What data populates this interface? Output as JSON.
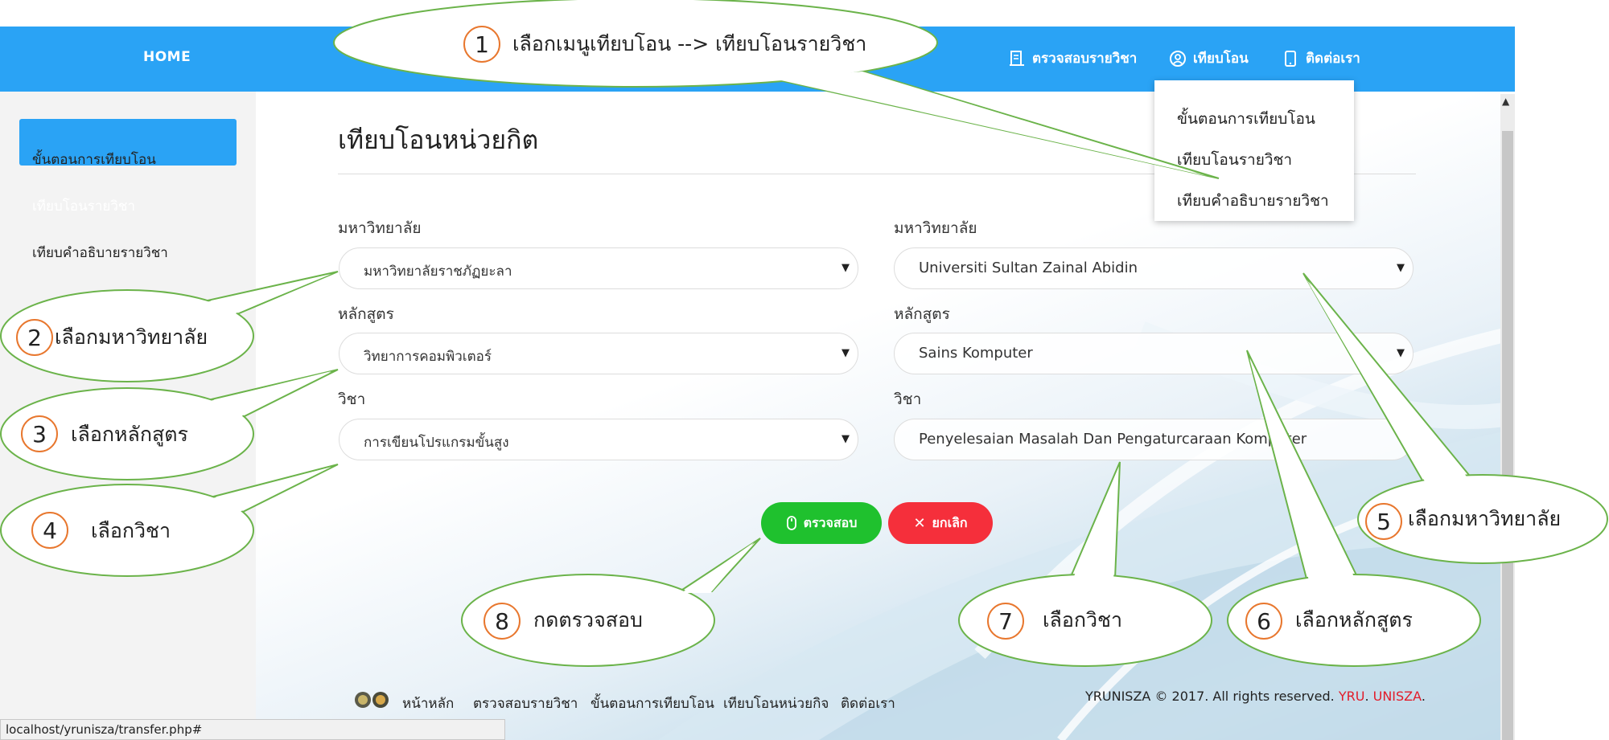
{
  "nav": {
    "home": "HOME",
    "check_course": "ตรวจสอบรายวิชา",
    "transfer": "เทียบโอน",
    "contact": "ติดต่อเรา"
  },
  "dropdown": [
    "ขั้นตอนการเทียบโอน",
    "เทียบโอนรายวิชา",
    "เทียบคำอธิบายรายวิชา"
  ],
  "sidebar": {
    "items": [
      {
        "label": "ขั้นตอนการเทียบโอน",
        "active": false
      },
      {
        "label": "เทียบโอนรายวิชา",
        "active": true
      },
      {
        "label": "เทียบคำอธิบายรายวิชา",
        "active": false
      }
    ]
  },
  "page": {
    "title": "เทียบโอนหน่วยกิต"
  },
  "form": {
    "left": {
      "university_label": "มหาวิทยาลัย",
      "university_value": "มหาวิทยาลัยราชภัฏยะลา",
      "program_label": "หลักสูตร",
      "program_value": "วิทยาการคอมพิวเตอร์",
      "course_label": "วิชา",
      "course_value": "การเขียนโปรแกรมขั้นสูง"
    },
    "right": {
      "university_label": "มหาวิทยาลัย",
      "university_value": "Universiti Sultan Zainal Abidin",
      "program_label": "หลักสูตร",
      "program_value": "Sains Komputer",
      "course_label": "วิชา",
      "course_value": "Penyelesaian Masalah Dan Pengaturcaraan Komputer"
    },
    "check_button": "ตรวจสอบ",
    "cancel_button": "ยกเลิก"
  },
  "footer": {
    "links": [
      "หน้าหลัก",
      "ตรวจสอบรายวิชา",
      "ขั้นตอนการเทียบโอน",
      "เทียบโอนหน่วยกิจ",
      "ติดต่อเรา"
    ],
    "copy_prefix": "YRUNISZA © 2017. All rights reserved.",
    "copy_yru": "YRU",
    "copy_dot": ".",
    "copy_unisza": "UNISZA",
    "copy_end": "."
  },
  "status_bar": "localhost/yrunisza/transfer.php#",
  "callouts": [
    {
      "num": "1",
      "text": "เลือกเมนูเทียบโอน --> เทียบโอนรายวิชา"
    },
    {
      "num": "2",
      "text": "เลือกมหาวิทยาลัย"
    },
    {
      "num": "3",
      "text": "เลือกหลักสูตร"
    },
    {
      "num": "4",
      "text": "เลือกวิชา"
    },
    {
      "num": "5",
      "text": "เลือกมหาวิทยาลัย"
    },
    {
      "num": "6",
      "text": "เลือกหลักสูตร"
    },
    {
      "num": "7",
      "text": "เลือกวิชา"
    },
    {
      "num": "8",
      "text": "กดตรวจสอบ"
    }
  ],
  "colors": {
    "nav_blue": "#2aa3f5",
    "check_green": "#1fc12e",
    "cancel_red": "#f52f3b",
    "callout_stroke": "#6bb34a",
    "number_circle": "#e8772e"
  }
}
